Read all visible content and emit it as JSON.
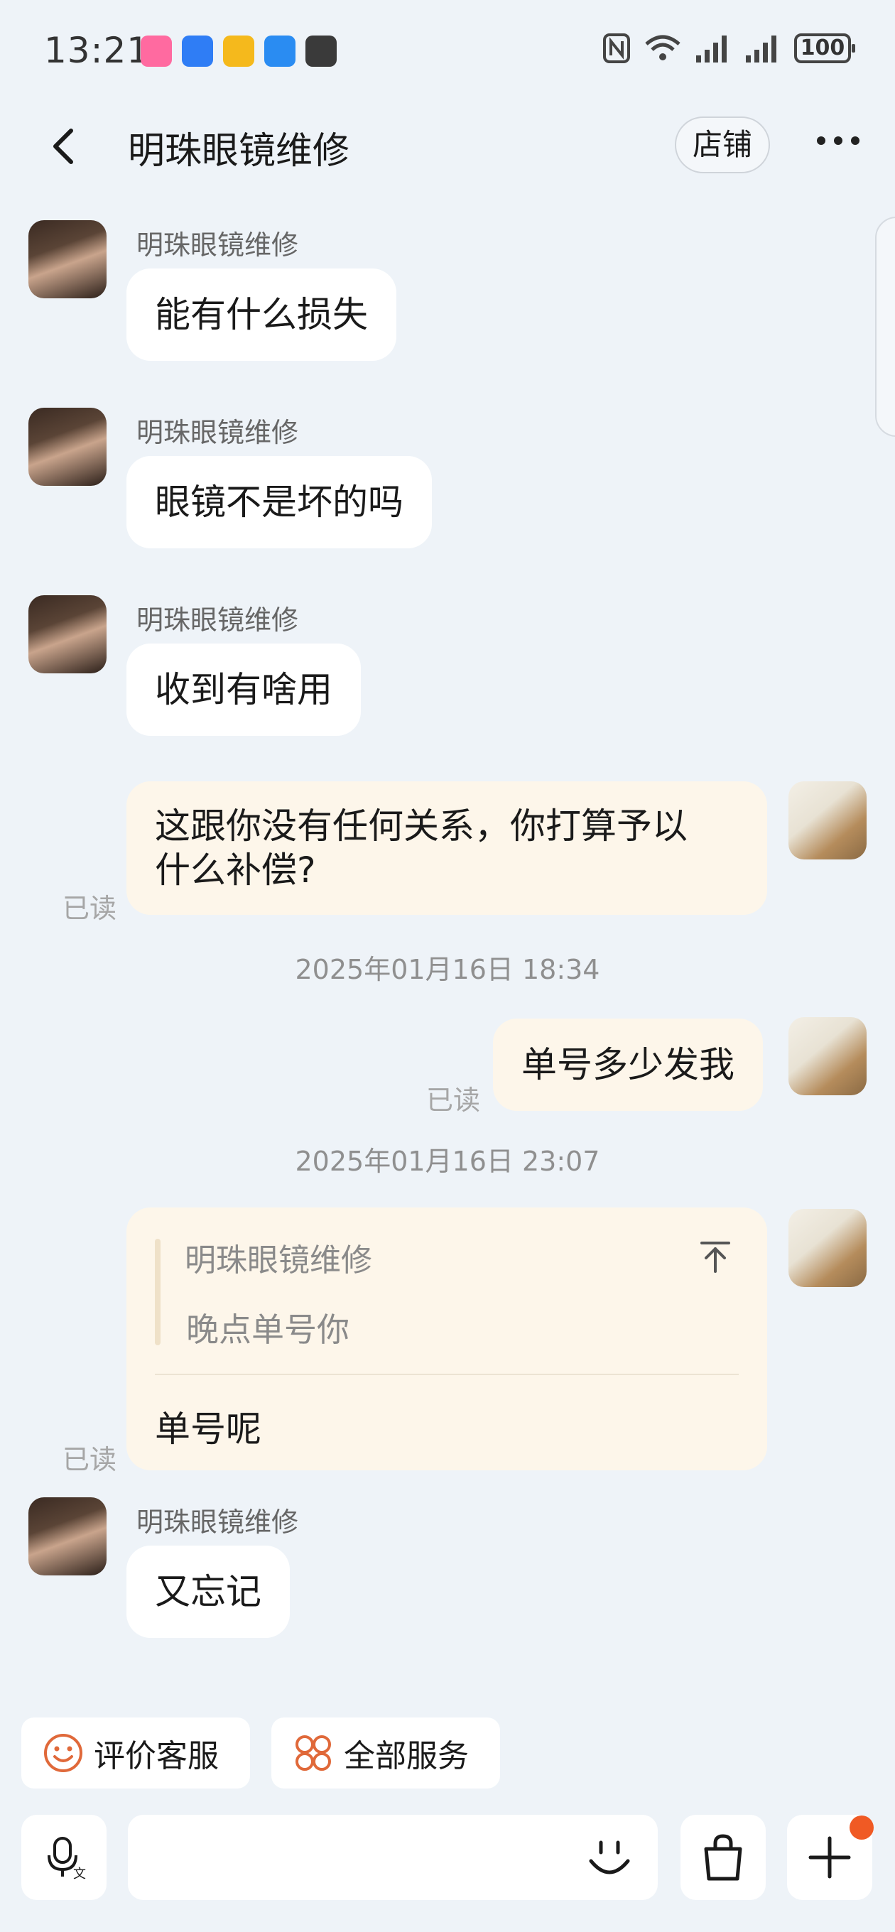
{
  "status_bar": {
    "time": "13:21",
    "battery": "100"
  },
  "header": {
    "title": "明珠眼镜维修",
    "shop_label": "店铺"
  },
  "messages": [
    {
      "sender": "明珠眼镜维修",
      "text": "能有什么损失"
    },
    {
      "sender": "明珠眼镜维修",
      "text": "眼镜不是坏的吗"
    },
    {
      "sender": "明珠眼镜维修",
      "text": "收到有啥用"
    },
    {
      "text_line1": "这跟你没有任何关系，你打算予以",
      "text_line2": "什么补偿?",
      "status": "已读"
    },
    {
      "timestamp": "2025年01月16日 18:34"
    },
    {
      "text": "单号多少发我",
      "status": "已读"
    },
    {
      "timestamp": "2025年01月16日 23:07"
    },
    {
      "quote_sender": "明珠眼镜维修",
      "quote_text": "晚点单号你",
      "text": "单号呢",
      "status": "已读"
    },
    {
      "sender": "明珠眼镜维修",
      "text": "又忘记"
    }
  ],
  "quick_actions": [
    {
      "label": "评价客服",
      "icon": "smiley-icon"
    },
    {
      "label": "全部服务",
      "icon": "grid-icon"
    }
  ],
  "input": {
    "value": ""
  },
  "colors": {
    "background": "#eef3f8",
    "incoming_bubble": "#ffffff",
    "outgoing_bubble": "#fdf6ea",
    "accent": "#e0693a",
    "notification_dot": "#f05a24"
  }
}
